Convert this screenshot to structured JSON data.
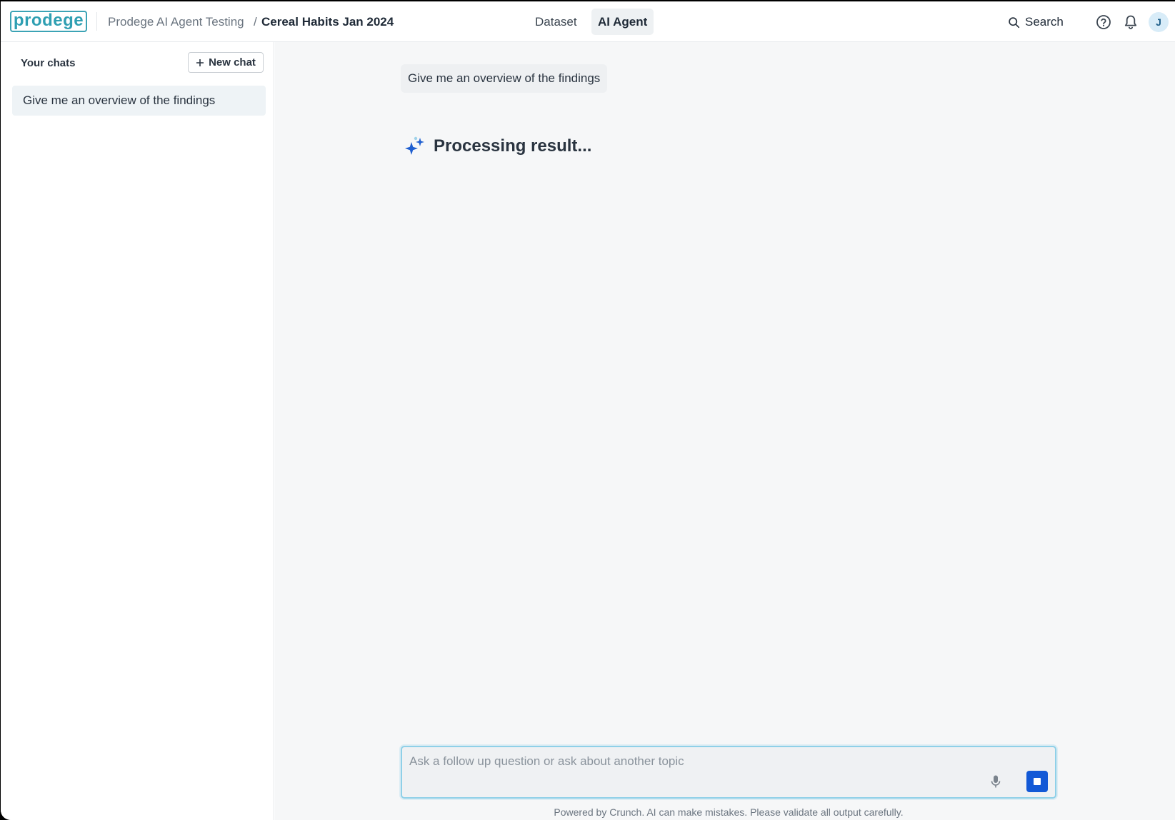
{
  "header": {
    "logo_text": "prodege",
    "breadcrumb_parent": "Prodege AI Agent Testing",
    "breadcrumb_separator": "/",
    "breadcrumb_current": "Cereal Habits Jan 2024",
    "tabs": [
      {
        "label": "Dataset",
        "active": false
      },
      {
        "label": "AI Agent",
        "active": true
      }
    ],
    "search_label": "Search",
    "avatar_initial": "J"
  },
  "sidebar": {
    "title": "Your chats",
    "new_chat_label": "New chat",
    "chats": [
      {
        "label": "Give me an overview of the findings",
        "selected": true
      }
    ]
  },
  "conversation": {
    "user_message": "Give me an overview of the findings",
    "status_text": "Processing result..."
  },
  "composer": {
    "placeholder": "Ask a follow up question or ask about another topic",
    "value": "",
    "disclaimer": "Powered by Crunch. AI can make mistakes. Please validate all output carefully."
  },
  "colors": {
    "brand": "#2f9fb2",
    "accent": "#1359d6",
    "focus_border": "#8fd0e8"
  },
  "icons": [
    "search-icon",
    "help-icon",
    "bell-icon",
    "plus-icon",
    "sparkle-icon",
    "mic-icon",
    "stop-icon"
  ]
}
